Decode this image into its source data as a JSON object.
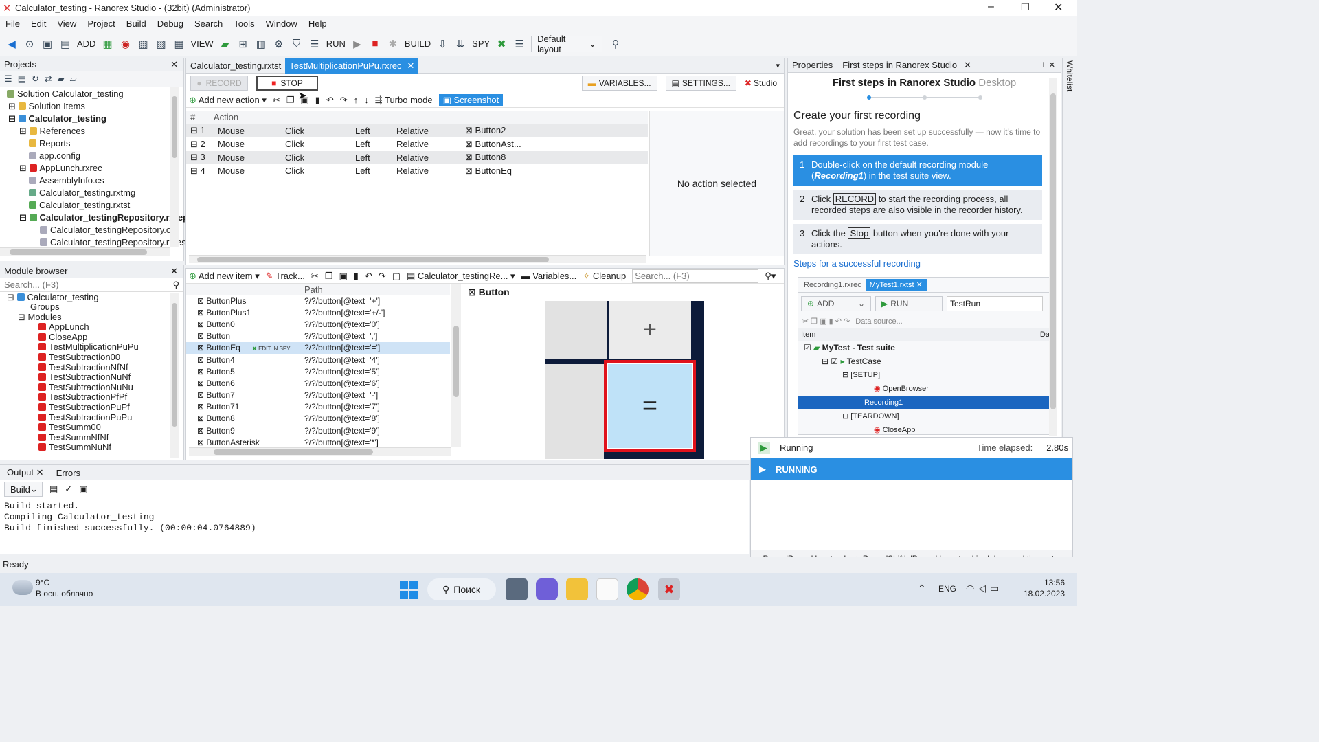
{
  "window": {
    "title": "Calculator_testing - Ranorex Studio - (32bit) (Administrator)"
  },
  "menu": [
    "File",
    "Edit",
    "View",
    "Project",
    "Build",
    "Debug",
    "Search",
    "Tools",
    "Window",
    "Help"
  ],
  "toolbar": {
    "add": "ADD",
    "view": "VIEW",
    "run": "RUN",
    "build": "BUILD",
    "spy": "SPY",
    "layout": "Default layout"
  },
  "projects": {
    "title": "Projects",
    "items": [
      "Solution Calculator_testing",
      "Solution Items",
      "Calculator_testing",
      "References",
      "Reports",
      "app.config",
      "AppLunch.rxrec",
      "AssemblyInfo.cs",
      "Calculator_testing.rxtmg",
      "Calculator_testing.rxtst",
      "Calculator_testingRepository.rxrep",
      "Calculator_testingRepository.cs",
      "Calculator_testingRepository.rxres"
    ]
  },
  "module_browser": {
    "title": "Module browser",
    "search_placeholder": "Search... (F3)",
    "items": [
      "Calculator_testing",
      "Groups",
      "Modules",
      "AppLunch",
      "CloseApp",
      "TestMultiplicationPuPu",
      "TestSubtraction00",
      "TestSubtractionNfNf",
      "TestSubtractionNuNf",
      "TestSubtractionNuNu",
      "TestSubtractionPfPf",
      "TestSubtractionPuPf",
      "TestSubtractionPuPu",
      "TestSumm00",
      "TestSummNfNf",
      "TestSummNuNf",
      "TestSummNuNu"
    ]
  },
  "editor": {
    "tabs": [
      "Calculator_testing.rxtst",
      "TestMultiplicationPuPu.rxrec"
    ],
    "record": "RECORD",
    "stop": "STOP",
    "variables": "VARIABLES...",
    "settings": "SETTINGS...",
    "studio": "Studio",
    "add_action": "Add new action",
    "turbo": "Turbo mode",
    "screenshot": "Screenshot",
    "col_num": "#",
    "col_action": "Action",
    "actions": [
      {
        "n": "1",
        "type": "Mouse",
        "act": "Click",
        "btn": "Left",
        "loc": "Relative",
        "item": "Button2"
      },
      {
        "n": "2",
        "type": "Mouse",
        "act": "Click",
        "btn": "Left",
        "loc": "Relative",
        "item": "ButtonAst..."
      },
      {
        "n": "3",
        "type": "Mouse",
        "act": "Click",
        "btn": "Left",
        "loc": "Relative",
        "item": "Button8"
      },
      {
        "n": "4",
        "type": "Mouse",
        "act": "Click",
        "btn": "Left",
        "loc": "Relative",
        "item": "ButtonEq"
      }
    ],
    "no_action": "No action selected"
  },
  "repository": {
    "add_item": "Add new item",
    "track": "Track...",
    "repo": "Calculator_testingRe...",
    "variables": "Variables...",
    "cleanup": "Cleanup",
    "search_placeholder": "Search... (F3)",
    "col_path": "Path",
    "edit_in_spy": "EDIT IN SPY",
    "items": [
      {
        "name": "ButtonPlus",
        "path": "?/?/button[@text='+']"
      },
      {
        "name": "ButtonPlus1",
        "path": "?/?/button[@text='+/-']"
      },
      {
        "name": "Button0",
        "path": "?/?/button[@text='0']"
      },
      {
        "name": "Button",
        "path": "?/?/button[@text=',']"
      },
      {
        "name": "ButtonEq",
        "path": "?/?/button[@text='=']"
      },
      {
        "name": "Button4",
        "path": "?/?/button[@text='4']"
      },
      {
        "name": "Button5",
        "path": "?/?/button[@text='5']"
      },
      {
        "name": "Button6",
        "path": "?/?/button[@text='6']"
      },
      {
        "name": "Button7",
        "path": "?/?/button[@text='-']"
      },
      {
        "name": "Button71",
        "path": "?/?/button[@text='7']"
      },
      {
        "name": "Button8",
        "path": "?/?/button[@text='8']"
      },
      {
        "name": "Button9",
        "path": "?/?/button[@text='9']"
      },
      {
        "name": "ButtonAsterisk",
        "path": "?/?/button[@text='*']"
      }
    ],
    "preview_title": "Button",
    "preview_plus": "+",
    "preview_eq": "="
  },
  "right_panel": {
    "tabs": [
      "Properties",
      "First steps in Ranorex Studio"
    ],
    "heading": "First steps in Ranorex Studio",
    "heading_suffix": "Desktop",
    "subheading": "Create your first recording",
    "intro": "Great, your solution has been set up successfully — now it's time to add recordings to your first test case.",
    "step1_num": "1",
    "step1_a": "Double-click on the default recording module (",
    "step1_em": "Recording1",
    "step1_b": ") in the test suite view.",
    "step2_num": "2",
    "step2_a": "Click ",
    "step2_key": "RECORD",
    "step2_b": " to start the recording process, all recorded steps are also visible in the recorder history.",
    "step3_num": "3",
    "step3_a": "Click the ",
    "step3_key": "Stop",
    "step3_b": " button when you're done with your actions.",
    "link": "Steps for a successful recording",
    "demo": {
      "tab1": "Recording1.rxrec",
      "tab2": "MyTest1.rxtst",
      "add": "ADD",
      "run": "RUN",
      "testrun": "TestRun",
      "datasource": "Data source...",
      "col_item": "Item",
      "col_dat": "Dat",
      "tree": [
        "MyTest - Test suite",
        "TestCase",
        "[SETUP]",
        "OpenBrowser",
        "Recording1",
        "[TEARDOWN]",
        "CloseApp"
      ]
    },
    "whitelist": "Whitelist"
  },
  "running": {
    "label": "Running",
    "elapsed_label": "Time elapsed:",
    "elapsed": "2.80s",
    "status": "RUNNING",
    "hint": "Press 'Pause' key to abort. Press 'Shift'+'Pause' keys to skip delays and timeouts."
  },
  "output": {
    "tabs": [
      "Output",
      "Errors"
    ],
    "filter": "Build",
    "lines": [
      "Build started.",
      "Compiling Calculator_testing",
      "Build finished successfully. (00:00:04.0764889)"
    ]
  },
  "status": "Ready",
  "taskbar": {
    "temp": "9°C",
    "weather": "В осн. облачно",
    "search": "Поиск",
    "lang": "ENG",
    "time": "13:56",
    "date": "18.02.2023"
  }
}
